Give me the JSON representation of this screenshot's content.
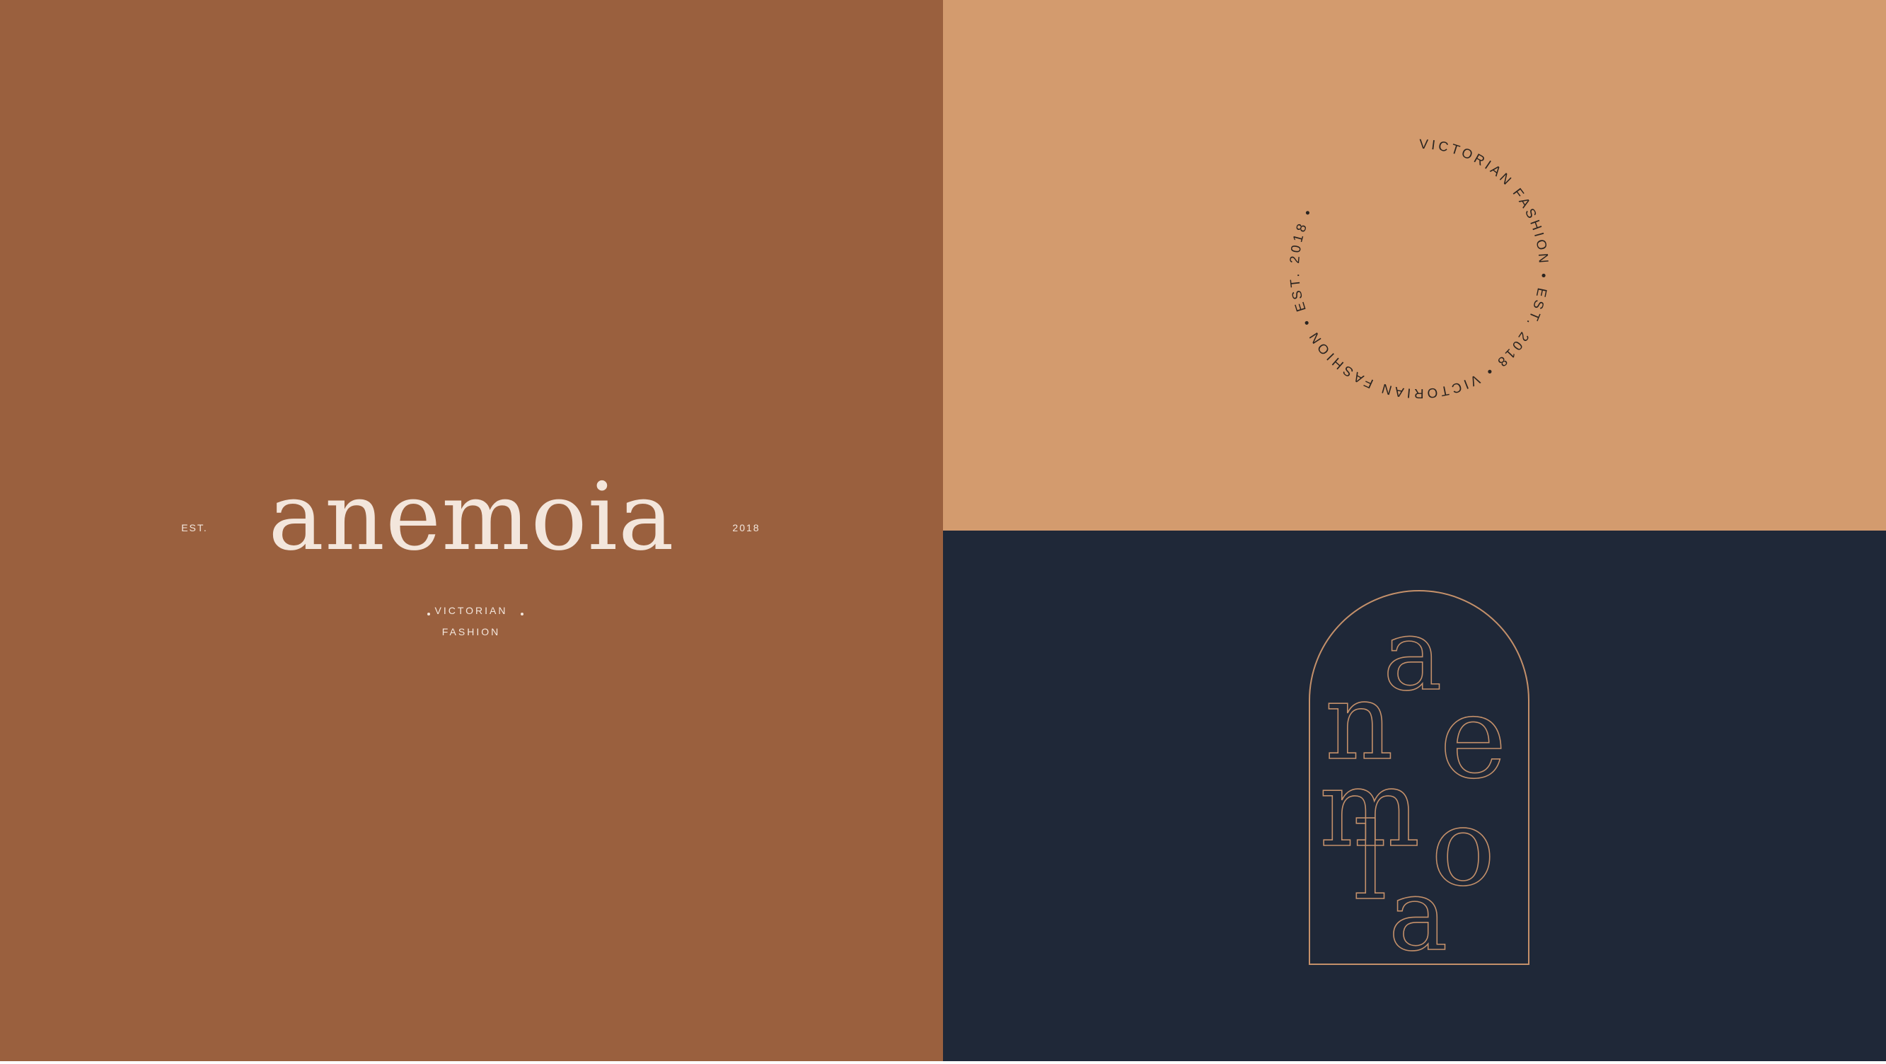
{
  "brand": {
    "wordmark": "anemoia",
    "est_label": "EST.",
    "year": "2018",
    "tagline_line1": "VICTORIAN",
    "tagline_line2": "FASHION"
  },
  "badge": {
    "circular_text": "VICTORIAN FASHION • EST. 2018 • VICTORIAN FASHION • EST. 2018 •"
  },
  "monogram": {
    "letters": [
      "a",
      "n",
      "e",
      "m",
      "l",
      "o",
      "a"
    ]
  },
  "colors": {
    "rust": "#9a603e",
    "tan": "#d39b6e",
    "navy": "#1f2838",
    "cream": "#f3e6dc",
    "line": "#c4906a",
    "ink": "#2a2420"
  }
}
